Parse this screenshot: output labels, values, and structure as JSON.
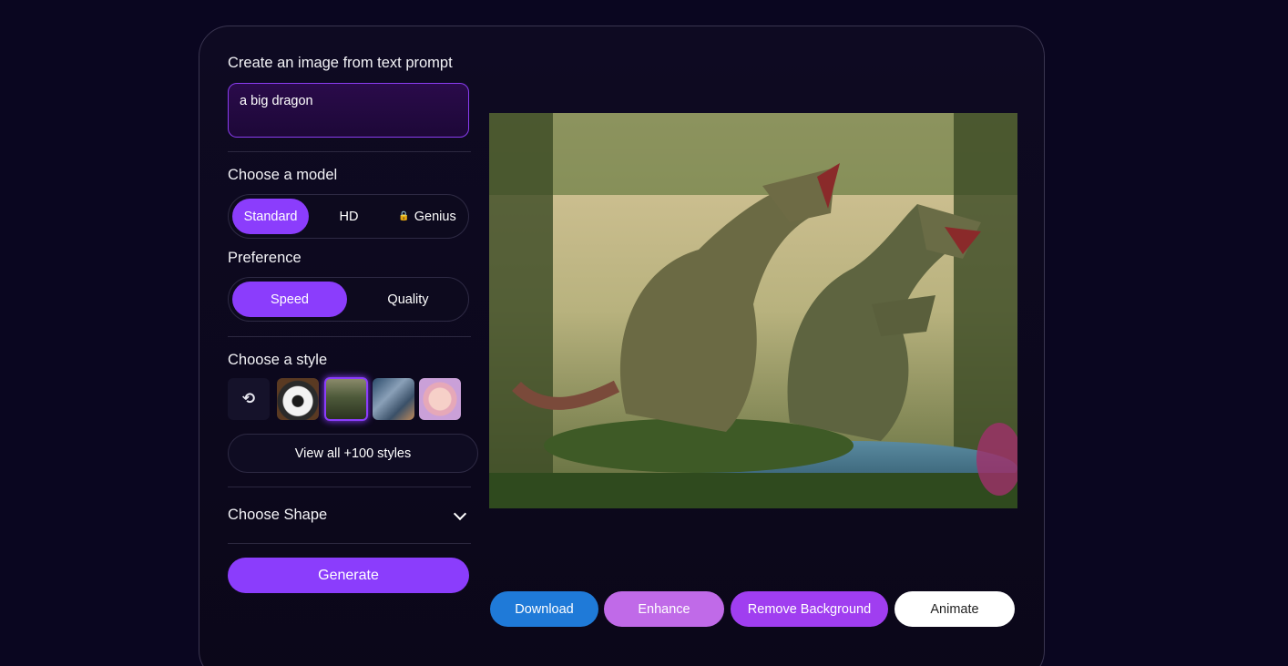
{
  "prompt_section": {
    "title": "Create an image from text prompt",
    "prompt_value": "a big dragon"
  },
  "model_section": {
    "title": "Choose a model",
    "options": [
      "Standard",
      "HD",
      "Genius"
    ],
    "selected": "Standard"
  },
  "preference_section": {
    "title": "Preference",
    "options": [
      "Speed",
      "Quality"
    ],
    "selected": "Speed"
  },
  "style_section": {
    "title": "Choose a style",
    "thumbnails": [
      "none-icon",
      "panda",
      "forest",
      "robot",
      "fantasy-face"
    ],
    "selected": "forest",
    "view_all_label": "View all +100 styles"
  },
  "shape_section": {
    "title": "Choose Shape"
  },
  "generate_label": "Generate",
  "actions": {
    "download": "Download",
    "enhance": "Enhance",
    "remove_background": "Remove Background",
    "animate": "Animate"
  },
  "colors": {
    "accent": "#8b3dfc",
    "download": "#1f7ad8",
    "enhance": "#c06ae8",
    "remove_background": "#a03ef0",
    "background": "#0a0620"
  }
}
